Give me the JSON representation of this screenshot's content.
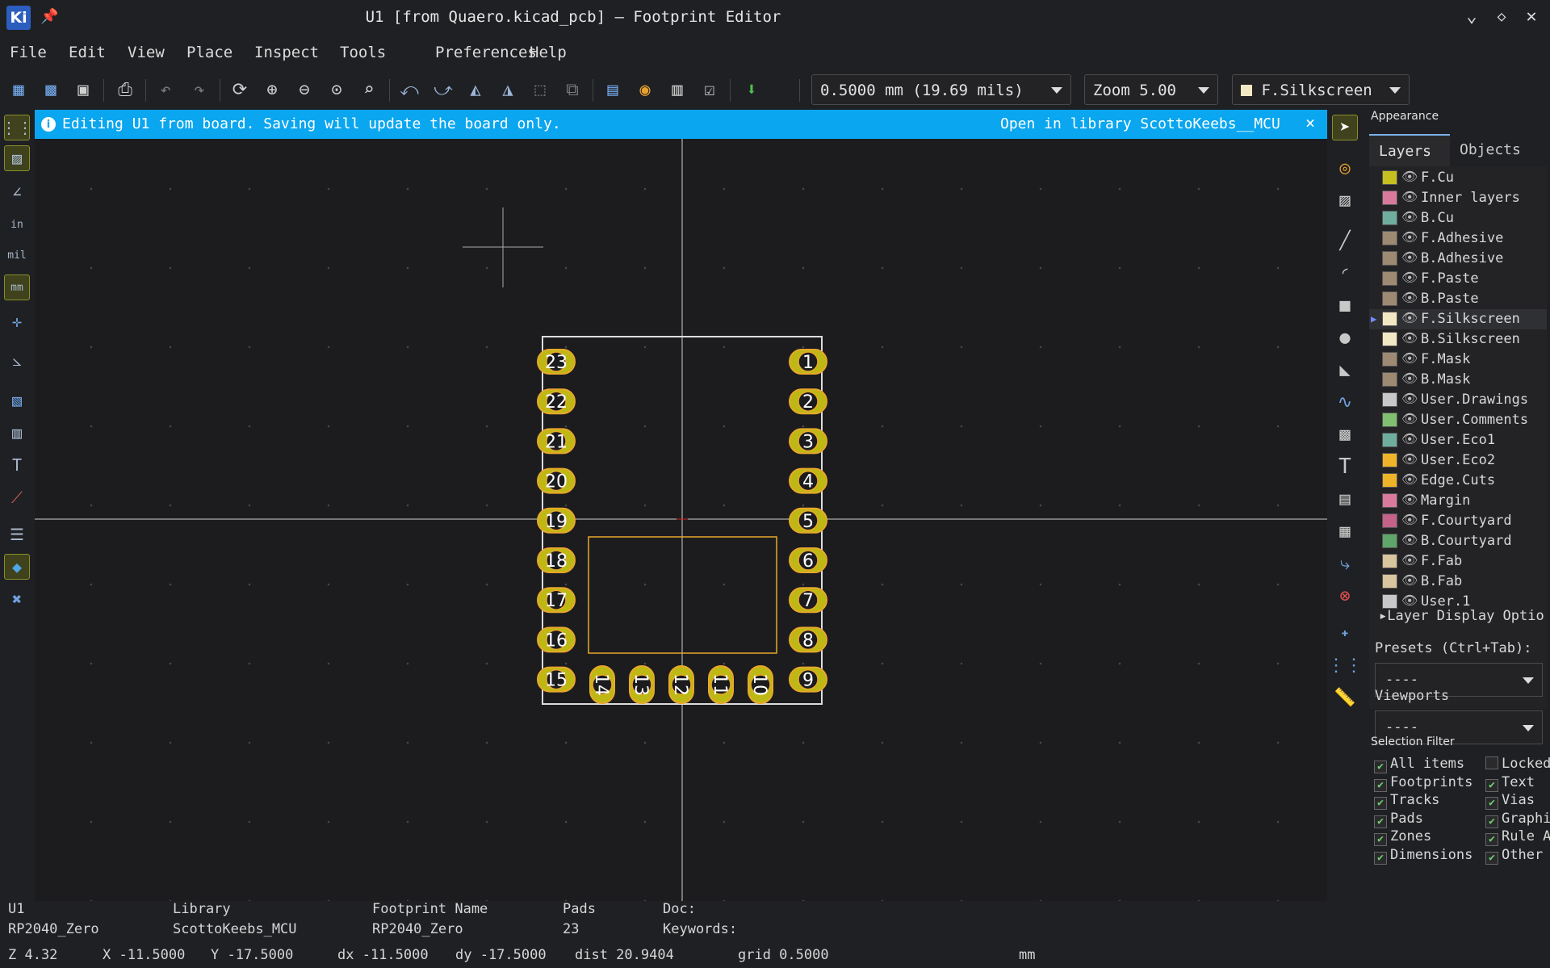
{
  "window": {
    "title": "U1 [from Quaero.kicad_pcb] — Footprint Editor",
    "logo": "Ki"
  },
  "menu": [
    "File",
    "Edit",
    "View",
    "Place",
    "Inspect",
    "Tools",
    "Preferences",
    "Help"
  ],
  "toolbar": {
    "grid_value": "0.5000 mm (19.69 mils)",
    "zoom_value": "Zoom 5.00",
    "layer_value": "F.Silkscreen",
    "layer_color": "#f2e8c4"
  },
  "infobar": {
    "message": "Editing U1 from board.  Saving will update the board only.",
    "link": "Open in library ScottoKeebs__MCU",
    "close": "×"
  },
  "footprint": {
    "left_pads": [
      "23",
      "22",
      "21",
      "20",
      "19",
      "18",
      "17",
      "16",
      "15"
    ],
    "right_pads": [
      "1",
      "2",
      "3",
      "4",
      "5",
      "6",
      "7",
      "8",
      "9"
    ],
    "bottom_pads": [
      "14",
      "13",
      "12",
      "11",
      "10"
    ],
    "pad_color": "#bdb814",
    "outline_color": "#e9a72c"
  },
  "appearance": {
    "title": "Appearance",
    "tabs": [
      "Layers",
      "Objects"
    ],
    "layers": [
      {
        "name": "F.Cu",
        "color": "#c5c01f"
      },
      {
        "name": "Inner layers",
        "color": "#d97a9c"
      },
      {
        "name": "B.Cu",
        "color": "#6fae9e"
      },
      {
        "name": "F.Adhesive",
        "color": "#9e8a72"
      },
      {
        "name": "B.Adhesive",
        "color": "#9e8a72"
      },
      {
        "name": "F.Paste",
        "color": "#9e8a72"
      },
      {
        "name": "B.Paste",
        "color": "#9e8a72"
      },
      {
        "name": "F.Silkscreen",
        "color": "#f2e8c4",
        "selected": true
      },
      {
        "name": "B.Silkscreen",
        "color": "#f2e8c4"
      },
      {
        "name": "F.Mask",
        "color": "#9e8a72"
      },
      {
        "name": "B.Mask",
        "color": "#9e8a72"
      },
      {
        "name": "User.Drawings",
        "color": "#c8c8c8"
      },
      {
        "name": "User.Comments",
        "color": "#7fbf6f"
      },
      {
        "name": "User.Eco1",
        "color": "#6fae9e"
      },
      {
        "name": "User.Eco2",
        "color": "#f0b428"
      },
      {
        "name": "Edge.Cuts",
        "color": "#f0b428"
      },
      {
        "name": "Margin",
        "color": "#d97a9c"
      },
      {
        "name": "F.Courtyard",
        "color": "#c4628a"
      },
      {
        "name": "B.Courtyard",
        "color": "#5ea66a"
      },
      {
        "name": "F.Fab",
        "color": "#d9c59e"
      },
      {
        "name": "B.Fab",
        "color": "#d9c59e"
      },
      {
        "name": "User.1",
        "color": "#c8c8c8"
      }
    ],
    "layer_display_options": "Layer Display Optio",
    "presets_label": "Presets (Ctrl+Tab):",
    "presets_value": "----",
    "viewports_label": "Viewports",
    "viewports_value": "----",
    "selection_filter_title": "Selection Filter",
    "selection_filter": [
      {
        "label": "All items",
        "checked": true
      },
      {
        "label": "Locked",
        "checked": false
      },
      {
        "label": "Footprints",
        "checked": true
      },
      {
        "label": "Text",
        "checked": true
      },
      {
        "label": "Tracks",
        "checked": true
      },
      {
        "label": "Vias",
        "checked": true
      },
      {
        "label": "Pads",
        "checked": true
      },
      {
        "label": "Graphi",
        "checked": true
      },
      {
        "label": "Zones",
        "checked": true
      },
      {
        "label": "Rule A",
        "checked": true
      },
      {
        "label": "Dimensions",
        "checked": true
      },
      {
        "label": "Other",
        "checked": true
      }
    ]
  },
  "status": {
    "ref": "U1",
    "value": "RP2040_Zero",
    "library_label": "Library",
    "library": "ScottoKeebs_MCU",
    "fpname_label": "Footprint Name",
    "fpname": "RP2040_Zero",
    "pads_label": "Pads",
    "pads": "23",
    "doc_label": "Doc:",
    "keywords_label": "Keywords:",
    "zoom": "Z 4.32",
    "x": "X -11.5000",
    "y": "Y -17.5000",
    "dx": "dx -11.5000",
    "dy": "dy -17.5000",
    "dist": "dist 20.9404",
    "grid": "grid 0.5000",
    "units": "mm"
  }
}
